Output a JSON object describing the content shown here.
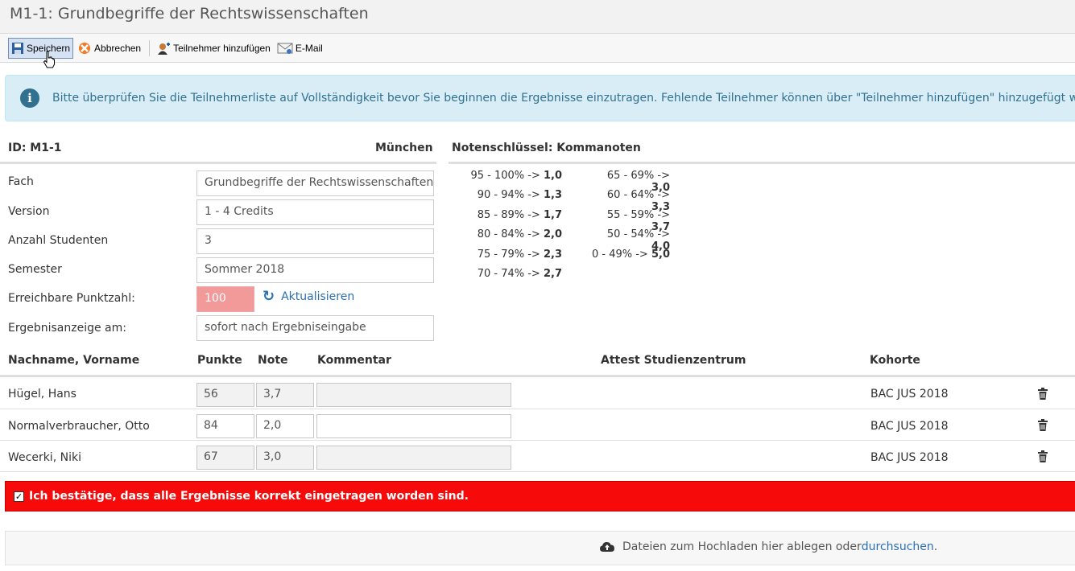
{
  "page": {
    "title": "M1-1: Grundbegriffe der Rechtswissenschaften"
  },
  "toolbar": {
    "save": "Speichern",
    "cancel": "Abbrechen",
    "add_participant": "Teilnehmer hinzufügen",
    "email": "E-Mail"
  },
  "info": {
    "icon": "info-icon",
    "text": "Bitte überprüfen Sie die Teilnehmerliste auf Vollständigkeit bevor Sie beginnen die Ergebnisse einzutragen. Fehlende Teilnehmer können über \"Teilnehmer hinzufügen\" hinzugefügt werden."
  },
  "exam": {
    "id_label": "ID: M1-1",
    "location": "München",
    "fields": [
      {
        "label": "Fach",
        "value": "Grundbegriffe der Rechtswissenschaften"
      },
      {
        "label": "Version",
        "value": "1 - 4 Credits"
      },
      {
        "label": "Anzahl Studenten",
        "value": "3"
      },
      {
        "label": "Semester",
        "value": "Sommer 2018"
      },
      {
        "label": "Erreichbare Punktzahl:",
        "value": "100"
      },
      {
        "label": "Ergebnisanzeige am:",
        "value": "sofort nach Ergebniseingabe"
      }
    ],
    "refresh_label": "Aktualisieren"
  },
  "grading": {
    "heading": "Notenschlüssel: Kommanoten",
    "col1": [
      {
        "range": "95 - 100% -> ",
        "grade": "1,0"
      },
      {
        "range": "90 - 94% -> ",
        "grade": "1,3"
      },
      {
        "range": "85 - 89% -> ",
        "grade": "1,7"
      },
      {
        "range": "80 - 84% -> ",
        "grade": "2,0"
      },
      {
        "range": "75 - 79% -> ",
        "grade": "2,3"
      },
      {
        "range": "70 - 74% -> ",
        "grade": "2,7"
      }
    ],
    "col2": [
      {
        "range": "65 - 69% -> ",
        "grade": "3,0"
      },
      {
        "range": "60 - 64% -> ",
        "grade": "3,3"
      },
      {
        "range": "55 - 59% -> ",
        "grade": "3,7"
      },
      {
        "range": "50 - 54% -> ",
        "grade": "4,0"
      },
      {
        "range": "0 - 49% -> ",
        "grade": "5,0"
      }
    ]
  },
  "table": {
    "headers": {
      "name": "Nachname, Vorname",
      "points": "Punkte",
      "grade": "Note",
      "comment": "Kommentar",
      "attest": "Attest Studienzentrum",
      "cohort": "Kohorte"
    },
    "rows": [
      {
        "name": "Hügel, Hans",
        "points": "56",
        "grade": "3,7",
        "comment": "",
        "cohort": "BAC JUS 2018"
      },
      {
        "name": "Normalverbraucher, Otto",
        "points": "84",
        "grade": "2,0",
        "comment": "",
        "cohort": "BAC JUS 2018"
      },
      {
        "name": "Wecerki, Niki",
        "points": "67",
        "grade": "3,0",
        "comment": "",
        "cohort": "BAC JUS 2018"
      }
    ]
  },
  "confirm": {
    "label": "Ich bestätige, dass alle Ergebnisse korrekt eingetragen worden sind.",
    "checked": true
  },
  "upload": {
    "text": "Dateien zum Hochladen hier ablegen oder ",
    "link": "durchsuchen",
    "suffix": "."
  }
}
